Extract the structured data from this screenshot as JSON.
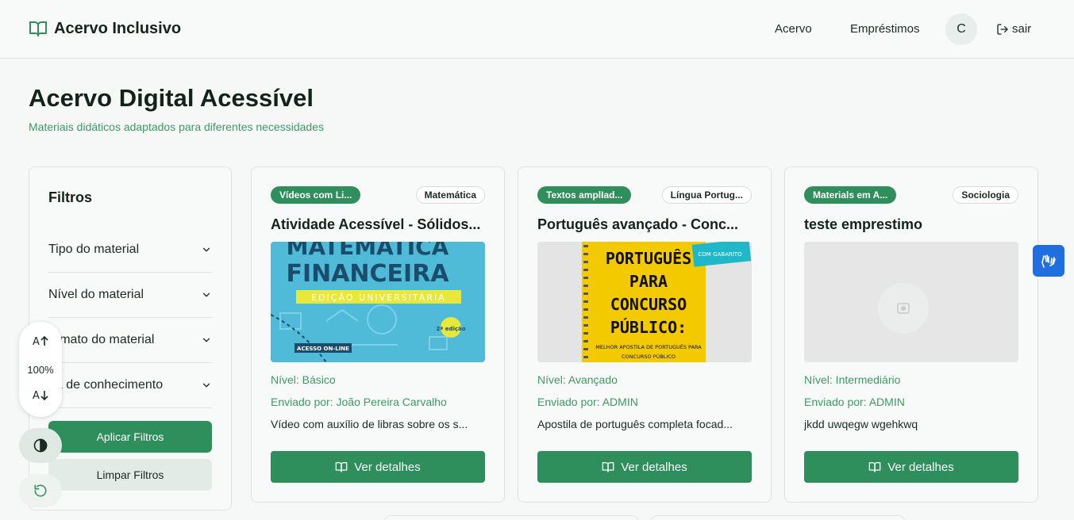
{
  "header": {
    "brand": "Acervo Inclusivo",
    "nav": [
      "Acervo",
      "Empréstimos"
    ],
    "avatar_initial": "C",
    "logout_label": "sair"
  },
  "page": {
    "title": "Acervo Digital Acessível",
    "subtitle": "Materiais didáticos adaptados para diferentes necessidades"
  },
  "filters": {
    "title": "Filtros",
    "items": [
      "Tipo do material",
      "Nível do material",
      "ormato do material",
      "ea de conhecimento"
    ],
    "apply_label": "Aplicar Filtros",
    "clear_label": "Limpar Filtros"
  },
  "accessibility": {
    "zoom": "100%"
  },
  "cards": [
    {
      "type_badge": "Vídeos com Li...",
      "subject_badge": "Matemática",
      "title": "Atividade Acessível - Sólidos...",
      "cover": {
        "line1": "MATEMÁTICA",
        "line2": "FINANCEIRA",
        "line3": "EDIÇÃO UNIVERSITÁRIA",
        "edition": "2ª edição",
        "access": "ACESSO ON-LINE"
      },
      "level": "Nível: Básico",
      "author": "Enviado por: João Pereira Carvalho",
      "description": "Vídeo com auxílio de libras sobre os s...",
      "button": "Ver detalhes"
    },
    {
      "type_badge": "Textos amplIad...",
      "subject_badge": "Língua Portug...",
      "title": "Português avançado - Conc...",
      "cover": {
        "line1": "PORTUGUÊS",
        "line2": "PARA",
        "line3": "CONCURSO",
        "line4": "PÚBLICO:",
        "line5": "MELHOR APOSTILA DE PORTUGUÊS PARA",
        "line6": "CONCURSO PÚBLICO",
        "tag": "COM GABARITO"
      },
      "level": "Nível: Avançado",
      "author": "Enviado por: ADMIN",
      "description": "Apostila de português completa focad...",
      "button": "Ver detalhes"
    },
    {
      "type_badge": "Materials em A...",
      "subject_badge": "Sociologia",
      "title": "teste emprestimo",
      "level": "Nível: Intermediário",
      "author": "Enviado por: ADMIN",
      "description": "jkdd uwqegw wgehkwq",
      "button": "Ver detalhes"
    }
  ],
  "colors": {
    "accent": "#2f8f5c",
    "accent_text": "#3d9a63",
    "libras": "#1f6fe0"
  }
}
